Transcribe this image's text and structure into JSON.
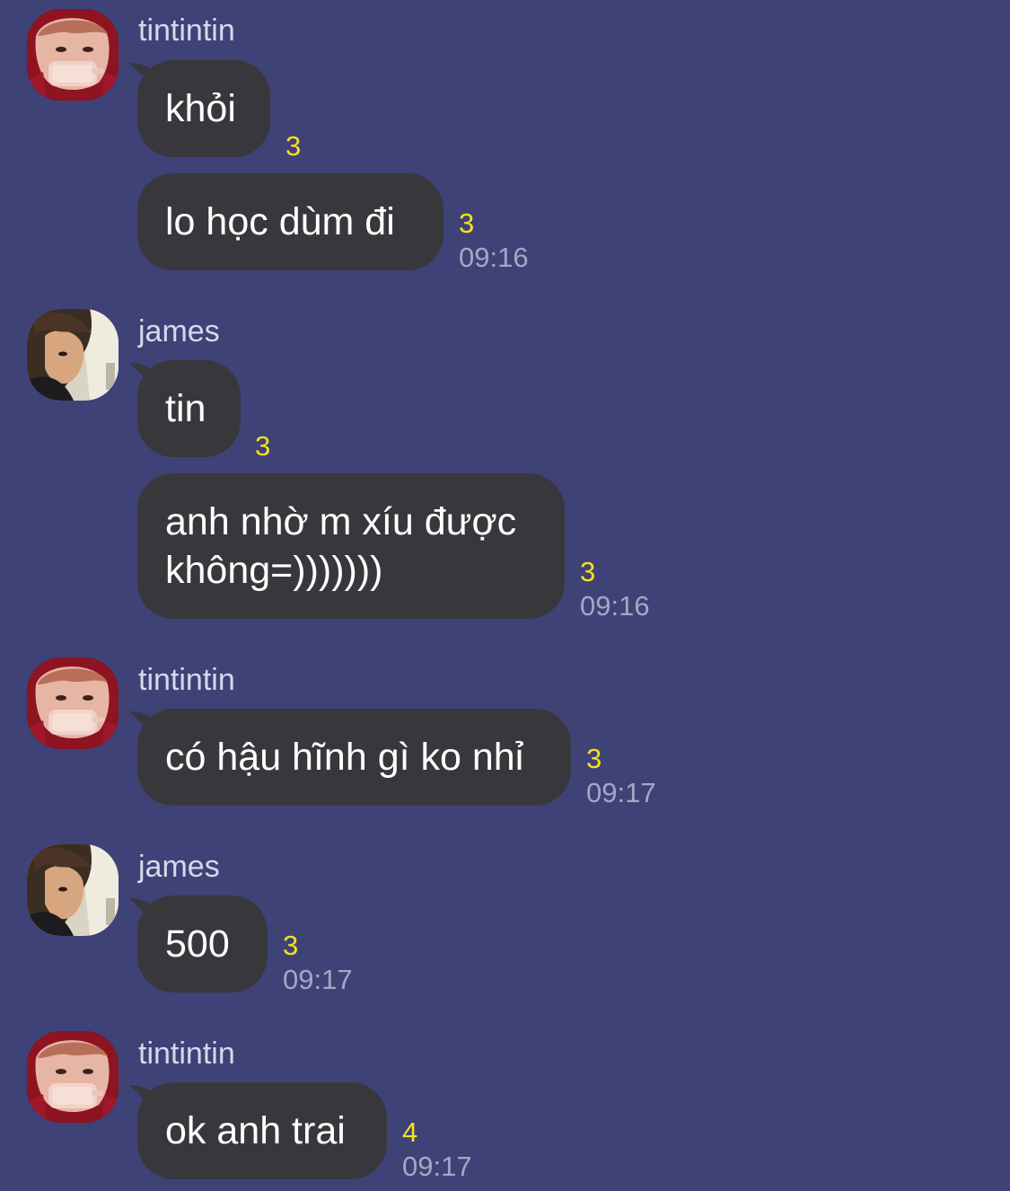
{
  "chat": {
    "groups": [
      {
        "sender": "tintintin",
        "avatar": "tintintin-avatar",
        "messages": [
          {
            "text": "khỏi",
            "read_count": "3",
            "time": ""
          },
          {
            "text": "lo học dùm đi",
            "read_count": "3",
            "time": "09:16"
          }
        ]
      },
      {
        "sender": "james",
        "avatar": "james-avatar",
        "messages": [
          {
            "text": "tin",
            "read_count": "3",
            "time": ""
          },
          {
            "text": "anh nhờ m xíu được\nkhông=)))))))",
            "read_count": "3",
            "time": "09:16"
          }
        ]
      },
      {
        "sender": "tintintin",
        "avatar": "tintintin-avatar",
        "messages": [
          {
            "text": "có hậu hĩnh gì ko nhỉ",
            "read_count": "3",
            "time": "09:17"
          }
        ]
      },
      {
        "sender": "james",
        "avatar": "james-avatar",
        "messages": [
          {
            "text": "500",
            "read_count": "3",
            "time": "09:17"
          }
        ]
      },
      {
        "sender": "tintintin",
        "avatar": "tintintin-avatar",
        "messages": [
          {
            "text": "ok anh trai",
            "read_count": "4",
            "time": "09:17"
          }
        ]
      }
    ]
  },
  "colors": {
    "background": "#3f4277",
    "bubble": "#38383c",
    "bubble_text": "#ffffff",
    "sender_text": "#d7d8ea",
    "read_count": "#f5e11c",
    "timestamp": "#a4a7c4"
  }
}
